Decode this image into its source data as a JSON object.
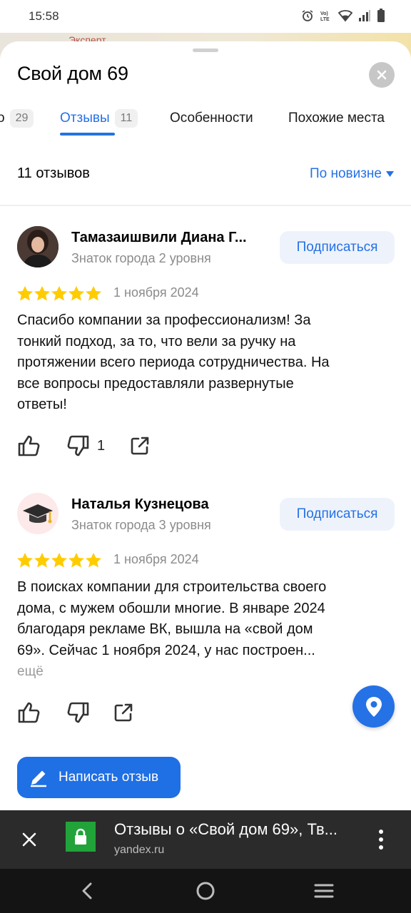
{
  "status_bar": {
    "time": "15:58",
    "icons": [
      "alarm-icon",
      "volte-icon",
      "wifi-icon",
      "signal-icon",
      "battery-icon"
    ],
    "volte_text": "Vo) LTE"
  },
  "map": {
    "label": "Эксперт"
  },
  "place": {
    "title": "Свой дом 69"
  },
  "tabs": [
    {
      "label": "о",
      "count": "29"
    },
    {
      "label": "Отзывы",
      "count": "11"
    },
    {
      "label": "Особенности",
      "count": ""
    },
    {
      "label": "Похожие места",
      "count": ""
    }
  ],
  "reviews_header": {
    "count_text": "11 отзывов",
    "sort_label": "По новизне"
  },
  "reviews": [
    {
      "author": "Тамазаишвили Диана Г...",
      "level": "Знаток города 2 уровня",
      "subscribe_label": "Подписаться",
      "rating": 5,
      "date": "1 ноября 2024",
      "text_lines": [
        "Спасибо компании за профессионализм! За",
        "тонкий подход, за то, что вели за ручку на",
        "протяжении всего периода сотрудничества. На",
        "все вопросы предоставляли развернутые",
        "ответы!"
      ],
      "dislike_count": "1"
    },
    {
      "author": "Наталья Кузнецова",
      "level": "Знаток города 3 уровня",
      "subscribe_label": "Подписаться",
      "rating": 5,
      "date": "1 ноября 2024",
      "text_lines": [
        "В поисках компании для строительства своего",
        "дома, с мужем обошли многие. В январе 2024",
        "благодаря рекламе ВК, вышла на «свой дом",
        "69». Сейчас 1 ноября 2024, у нас построен..."
      ],
      "more_label": "ещё"
    }
  ],
  "write_review_label": "Написать отзыв",
  "browser": {
    "page_title": "Отзывы о «Свой дом 69», Тв...",
    "url": "yandex.ru"
  },
  "colors": {
    "accent": "#2571e6",
    "star": "#ffcc00",
    "secure": "#21a33a"
  }
}
